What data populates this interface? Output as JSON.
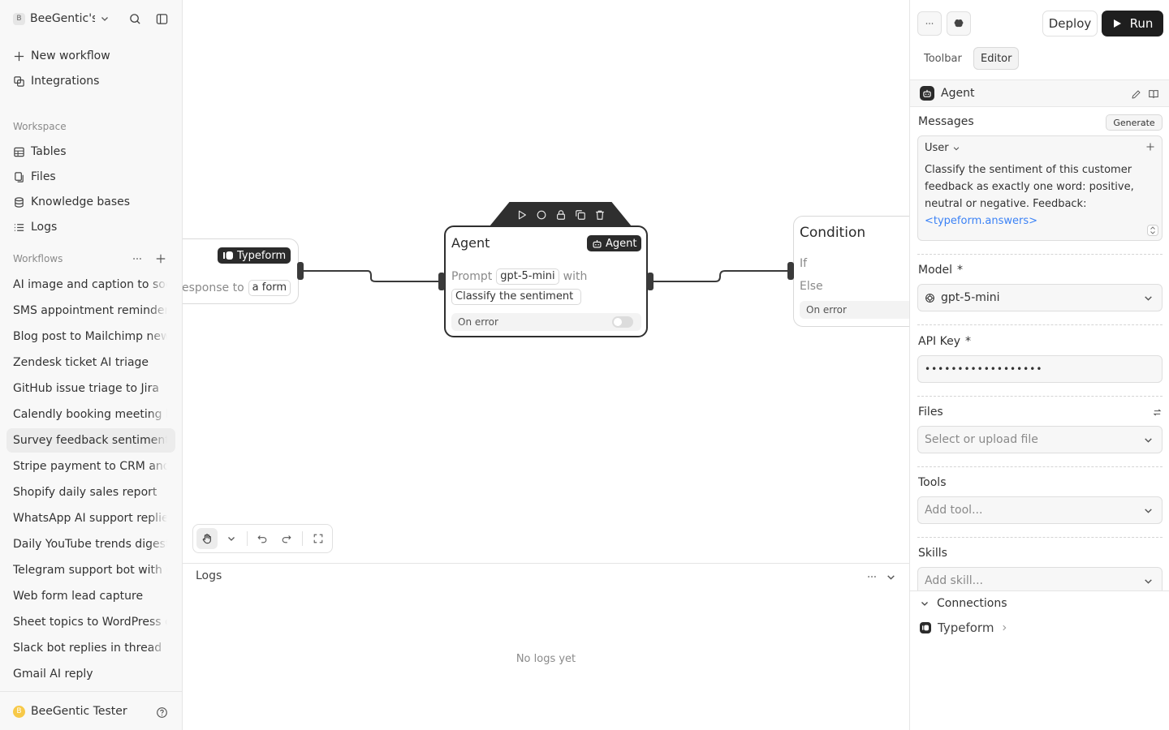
{
  "sidebar": {
    "workspace_avatar": "B",
    "workspace_name": "BeeGentic's",
    "nav": [
      {
        "label": "New workflow",
        "icon": "plus-icon"
      },
      {
        "label": "Integrations",
        "icon": "integrations-icon"
      }
    ],
    "workspace_label": "Workspace",
    "workspace_items": [
      {
        "label": "Tables",
        "icon": "table-icon"
      },
      {
        "label": "Files",
        "icon": "files-icon"
      },
      {
        "label": "Knowledge bases",
        "icon": "database-icon"
      },
      {
        "label": "Logs",
        "icon": "list-icon"
      }
    ],
    "workflows_label": "Workflows",
    "workflows": [
      "AI image and caption to social",
      "SMS appointment reminders",
      "Blog post to Mailchimp newsletter",
      "Zendesk ticket AI triage",
      "GitHub issue triage to Jira",
      "Calendly booking meeting brief",
      "Survey feedback sentiment",
      "Stripe payment to CRM and",
      "Shopify daily sales report",
      "WhatsApp AI support replies",
      "Daily YouTube trends digest",
      "Telegram support bot with GPT",
      "Web form lead capture",
      "Sheet topics to WordPress drafts",
      "Slack bot replies in thread",
      "Gmail AI reply"
    ],
    "active_workflow_index": 6,
    "user_avatar": "B",
    "user_name": "BeeGentic Tester"
  },
  "canvas": {
    "typeform_node": {
      "tag": "Typeform",
      "text_prefix": "esponse to",
      "pill": "a form"
    },
    "agent_node": {
      "title": "Agent",
      "tag": "Agent",
      "prompt_label": "Prompt",
      "model_pill": "gpt-5-mini",
      "with_label": "with",
      "prompt_pill": "Classify the sentiment",
      "on_error": "On error"
    },
    "condition_node": {
      "title": "Condition",
      "if_label": "If",
      "else_label": "Else",
      "on_error": "On error"
    }
  },
  "logs": {
    "title": "Logs",
    "empty": "No logs yet"
  },
  "panel": {
    "deploy": "Deploy",
    "run": "Run",
    "tabs": [
      "Toolbar",
      "Editor"
    ],
    "active_tab": 1,
    "block_title": "Agent",
    "messages_label": "Messages",
    "generate": "Generate",
    "message_role": "User",
    "message_text": "Classify the sentiment of this customer feedback as exactly one word: positive, neutral or negative. Feedback:",
    "message_ref": "<typeform.answers>",
    "model_label": "Model",
    "model_value": "gpt-5-mini",
    "required_mark": "*",
    "api_key_label": "API Key",
    "api_key_value": "••••••••••••••••••",
    "files_label": "Files",
    "files_placeholder": "Select or upload file",
    "tools_label": "Tools",
    "tools_placeholder": "Add tool...",
    "skills_label": "Skills",
    "skills_placeholder": "Add skill...",
    "connections_label": "Connections",
    "connection_item": "Typeform"
  }
}
